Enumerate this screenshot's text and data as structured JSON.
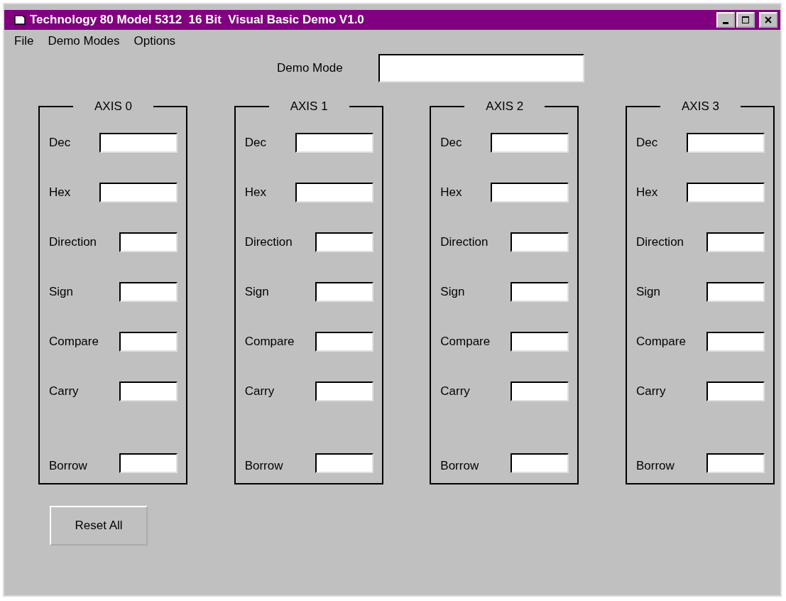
{
  "window": {
    "title": "Technology 80 Model 5312  16 Bit  Visual Basic Demo V1.0"
  },
  "menu": [
    "File",
    "Demo Modes",
    "Options"
  ],
  "demo_mode": {
    "label": "Demo Mode"
  },
  "axes": [
    {
      "title": "AXIS 0",
      "fields": [
        "Dec",
        "Hex",
        "Direction",
        "Sign",
        "Compare",
        "Carry",
        "Borrow"
      ]
    },
    {
      "title": "AXIS 1",
      "fields": [
        "Dec",
        "Hex",
        "Direction",
        "Sign",
        "Compare",
        "Carry",
        "Borrow"
      ]
    },
    {
      "title": "AXIS 2",
      "fields": [
        "Dec",
        "Hex",
        "Direction",
        "Sign",
        "Compare",
        "Carry",
        "Borrow"
      ]
    },
    {
      "title": "AXIS 3",
      "fields": [
        "Dec",
        "Hex",
        "Direction",
        "Sign",
        "Compare",
        "Carry",
        "Borrow"
      ]
    }
  ],
  "buttons": [
    "Reset All"
  ]
}
